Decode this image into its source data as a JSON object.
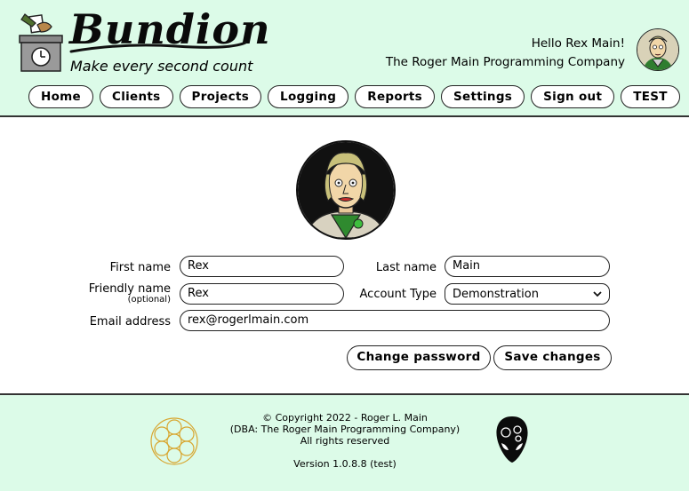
{
  "header": {
    "brand": "Bundion",
    "tagline": "Make every second count",
    "greeting": "Hello Rex Main!",
    "company": "The Roger Main Programming Company"
  },
  "nav": [
    {
      "label": "Home"
    },
    {
      "label": "Clients"
    },
    {
      "label": "Projects"
    },
    {
      "label": "Logging"
    },
    {
      "label": "Reports"
    },
    {
      "label": "Settings"
    },
    {
      "label": "Sign out"
    },
    {
      "label": "TEST"
    }
  ],
  "form": {
    "first_name_label": "First name",
    "first_name_value": "Rex",
    "last_name_label": "Last name",
    "last_name_value": "Main",
    "friendly_name_label": "Friendly name",
    "friendly_name_hint": "(optional)",
    "friendly_name_value": "Rex",
    "account_type_label": "Account Type",
    "account_type_value": "Demonstration",
    "email_label": "Email address",
    "email_value": "rex@rogerlmain.com",
    "change_password_label": "Change password",
    "save_changes_label": "Save changes"
  },
  "footer": {
    "copyright": "© Copyright 2022 - Roger L. Main",
    "dba": "(DBA: The Roger Main Programming Company)",
    "rights": "All rights reserved",
    "version": "Version 1.0.8.8 (test)"
  },
  "colors": {
    "header_bg": "#dcfbe8",
    "footer_bg": "#dcfbe8",
    "accent": "#d8a630"
  }
}
